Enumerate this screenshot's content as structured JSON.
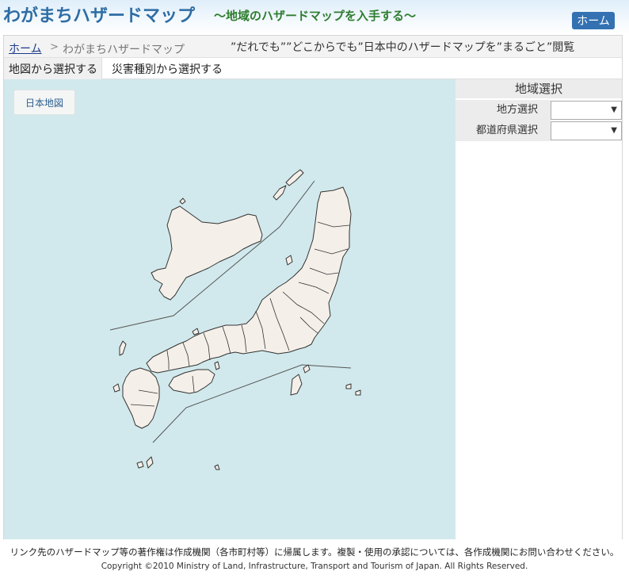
{
  "header": {
    "title": "わがまちハザードマップ",
    "subtitle": "〜地域のハザードマップを入手する〜",
    "home_button": "ホーム"
  },
  "breadcrumb": {
    "home": "ホーム",
    "separator": ">",
    "current": "わがまちハザードマップ"
  },
  "tagline": "”だれでも””どこからでも”日本中のハザードマップを”まるごと”閲覧",
  "tabs": [
    {
      "label": "地図から選択する",
      "active": true
    },
    {
      "label": "災害種別から選択する",
      "active": false
    }
  ],
  "map": {
    "button_label": "日本地図",
    "sea_color": "#d1e9ec",
    "land_color": "#f5efe9"
  },
  "panel": {
    "title": "地域選択",
    "region_label": "地方選択",
    "region_value": "",
    "prefecture_label": "都道府県選択",
    "prefecture_value": ""
  },
  "footer": {
    "notice": "リンク先のハザードマップ等の著作権は作成機関（各市町村等）に帰属します。複製・使用の承認については、各作成機関にお問い合わせください。",
    "copyright": "Copyright ©2010 Ministry of Land, Infrastructure, Transport and Tourism of Japan. All Rights Reserved."
  },
  "colors": {
    "brand_blue": "#2e6da4",
    "subtitle_green": "#2f7d2f",
    "home_button_bg": "#3471b2"
  }
}
